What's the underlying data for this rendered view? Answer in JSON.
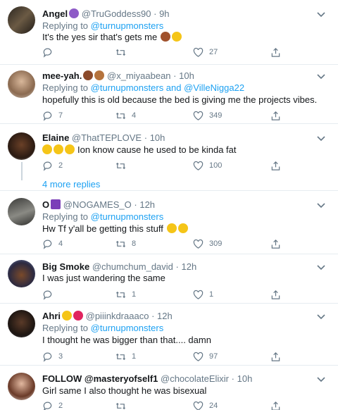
{
  "tweets": [
    {
      "name": "Angel",
      "handle": "@TruGoddess90",
      "time": "9h",
      "reply_prefix": "Replying to",
      "reply_to": "@turnupmonsters",
      "text": "It's the yes sir that's gets me",
      "counts": {
        "reply": "",
        "retweet": "",
        "like": "27"
      }
    },
    {
      "name": "mee-yah.",
      "handle": "@x_miyaabean",
      "time": "10h",
      "reply_prefix": "Replying to",
      "reply_to": "@turnupmonsters and @VilleNigga22",
      "text": "hopefully this is old because the bed is giving me the projects vibes.",
      "counts": {
        "reply": "7",
        "retweet": "4",
        "like": "349"
      }
    },
    {
      "name": "Elaine",
      "handle": "@ThatTEPLOVE",
      "time": "10h",
      "text": "Ion know cause he used to be kinda fat",
      "counts": {
        "reply": "2",
        "retweet": "",
        "like": "100"
      }
    },
    {
      "name": "O",
      "handle": "@NOGAMES_O",
      "time": "12h",
      "reply_prefix": "Replying to",
      "reply_to": "@turnupmonsters",
      "text": "Hw Tf y'all be getting this stuff",
      "counts": {
        "reply": "4",
        "retweet": "8",
        "like": "309"
      }
    },
    {
      "name": "Big Smoke",
      "handle": "@chumchum_david",
      "time": "12h",
      "text": "I was just wandering the same",
      "counts": {
        "reply": "",
        "retweet": "1",
        "like": "1"
      }
    },
    {
      "name": "Ahri",
      "handle": "@piiinkdraaaco",
      "time": "12h",
      "reply_prefix": "Replying to",
      "reply_to": "@turnupmonsters",
      "text": "I thought he was bigger than that.... damn",
      "counts": {
        "reply": "3",
        "retweet": "1",
        "like": "97"
      }
    },
    {
      "name": "FOLLOW @masteryofself1",
      "handle": "@chocolateElixir",
      "time": "10h",
      "text": "Girl same I also thought he was bisexual",
      "counts": {
        "reply": "2",
        "retweet": "",
        "like": "24"
      }
    }
  ],
  "show_more": "4 more replies",
  "separator": "·",
  "colors": {
    "link": "#1da1f2",
    "muted": "#657786",
    "divider": "#e6ecf0",
    "thread": "#ccd6dd"
  }
}
